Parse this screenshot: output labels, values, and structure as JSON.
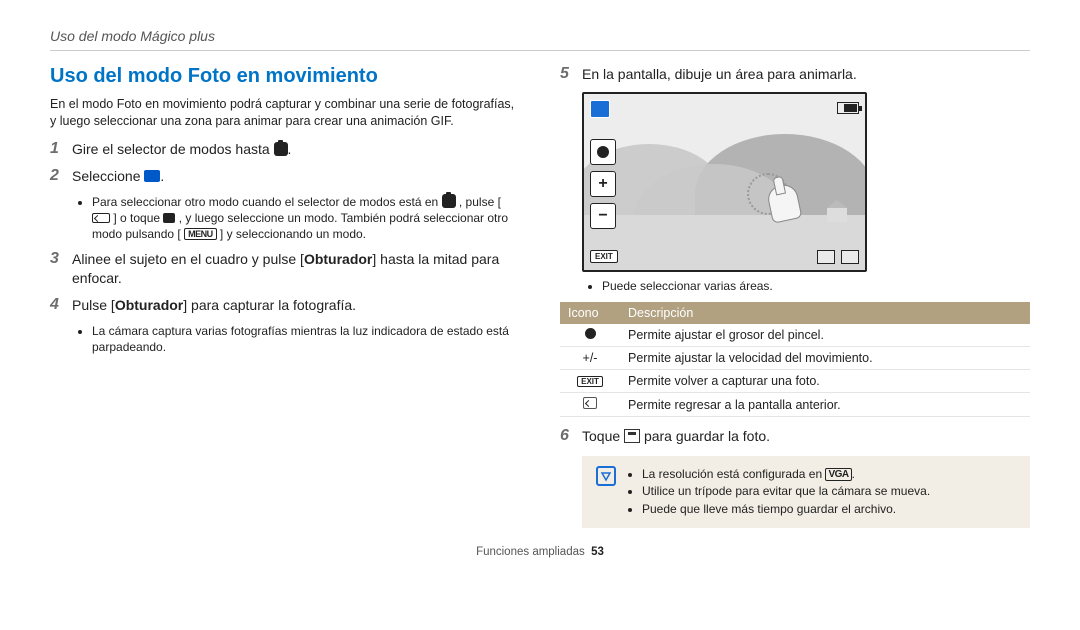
{
  "header": "Uso del modo Mágico plus",
  "title": "Uso del modo Foto en movimiento",
  "intro": "En el modo Foto en movimiento podrá capturar y combinar una serie de fotografías, y luego seleccionar una zona para animar para crear una animación GIF.",
  "steps": {
    "s1": {
      "n": "1",
      "text_pre": "Gire el selector de modos hasta ",
      "text_post": "."
    },
    "s2": {
      "n": "2",
      "text_pre": "Seleccione ",
      "text_post": "."
    },
    "s2sub": {
      "a_pre": "Para seleccionar otro modo cuando el selector de modos está en ",
      "a_mid1": ", pulse [",
      "a_mid2": "] o toque ",
      "a_mid3": ", y luego seleccione un modo. También podrá seleccionar otro modo pulsando [",
      "a_post": "] y seleccionando un modo.",
      "menu": "MENU"
    },
    "s3": {
      "n": "3",
      "pre": "Alinee el sujeto en el cuadro y pulse [",
      "obt": "Obturador",
      "post": "] hasta la mitad para enfocar."
    },
    "s4": {
      "n": "4",
      "pre": "Pulse [",
      "obt": "Obturador",
      "post": "] para capturar la fotografía."
    },
    "s4sub": "La cámara captura varias fotografías mientras la luz indicadora de estado está parpadeando.",
    "s5": {
      "n": "5",
      "text": "En la pantalla, dibuje un área para animarla."
    },
    "s5sub": "Puede seleccionar varias áreas.",
    "s6": {
      "n": "6",
      "pre": "Toque ",
      "post": " para guardar la foto."
    }
  },
  "exit_label": "EXIT",
  "table": {
    "h1": "Icono",
    "h2": "Descripción",
    "r1": {
      "icon": "dot",
      "desc": "Permite ajustar el grosor del pincel."
    },
    "r2": {
      "icon_text": "+/-",
      "desc": "Permite ajustar la velocidad del movimiento."
    },
    "r3": {
      "icon_text": "EXIT",
      "desc": "Permite volver a capturar una foto."
    },
    "r4": {
      "icon": "back",
      "desc": "Permite regresar a la pantalla anterior."
    }
  },
  "note": {
    "l1_pre": "La resolución está configurada en ",
    "l1_vga": "VGA",
    "l1_post": ".",
    "l2": "Utilice un trípode para evitar que la cámara se mueva.",
    "l3": "Puede que lleve más tiempo guardar el archivo."
  },
  "footer": {
    "section": "Funciones ampliadas",
    "page": "53"
  }
}
